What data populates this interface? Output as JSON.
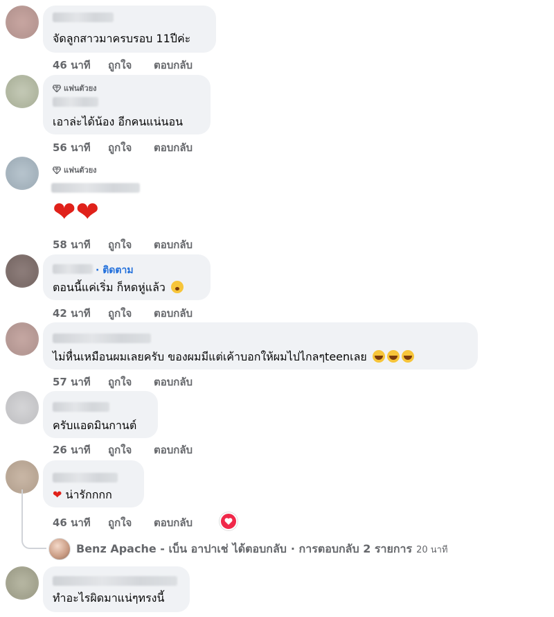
{
  "comments": [
    {
      "text": "จัดลูกสาวมาครบรอบ 11ปีค่ะ",
      "time": "46 นาที",
      "like": "ถูกใจ",
      "reply": "ตอบกลับ"
    },
    {
      "badge": "แฟนตัวยง",
      "text": "เอาล่ะได้น้อง อีกคนแน่นอน",
      "time": "56 นาที",
      "like": "ถูกใจ",
      "reply": "ตอบกลับ"
    },
    {
      "badge": "แฟนตัวยง",
      "text": "❤❤",
      "time": "58 นาที",
      "like": "ถูกใจ",
      "reply": "ตอบกลับ"
    },
    {
      "follow": "· ติดตาม",
      "text": "ตอนนี้แค่เริ่ม ก็หดหู่แล้ว",
      "time": "42 นาที",
      "like": "ถูกใจ",
      "reply": "ตอบกลับ"
    },
    {
      "text": "ไม่หื่นเหมือนผมเลยครับ ของผมมีแต่เค้าบอกให้ผมไปไกลๆteenเลย",
      "time": "57 นาที",
      "like": "ถูกใจ",
      "reply": "ตอบกลับ"
    },
    {
      "text": "ครับแอดมินกานต์",
      "time": "26 นาที",
      "like": "ถูกใจ",
      "reply": "ตอบกลับ"
    },
    {
      "text": "น่ารักกกก",
      "time": "46 นาที",
      "like": "ถูกใจ",
      "reply": "ตอบกลับ"
    },
    {
      "text": "ทำอะไรผิดมาแน่ๆทรงนี้"
    }
  ],
  "reply_summary": {
    "name": "Benz Apache - เบ็น อาปาเช่",
    "action": "ได้ตอบกลับ",
    "count": "· การตอบกลับ 2 รายการ",
    "time": "20 นาที"
  },
  "colors": {
    "accent": "#216fdb",
    "heart": "#f02849",
    "bubble": "#f0f2f5"
  }
}
